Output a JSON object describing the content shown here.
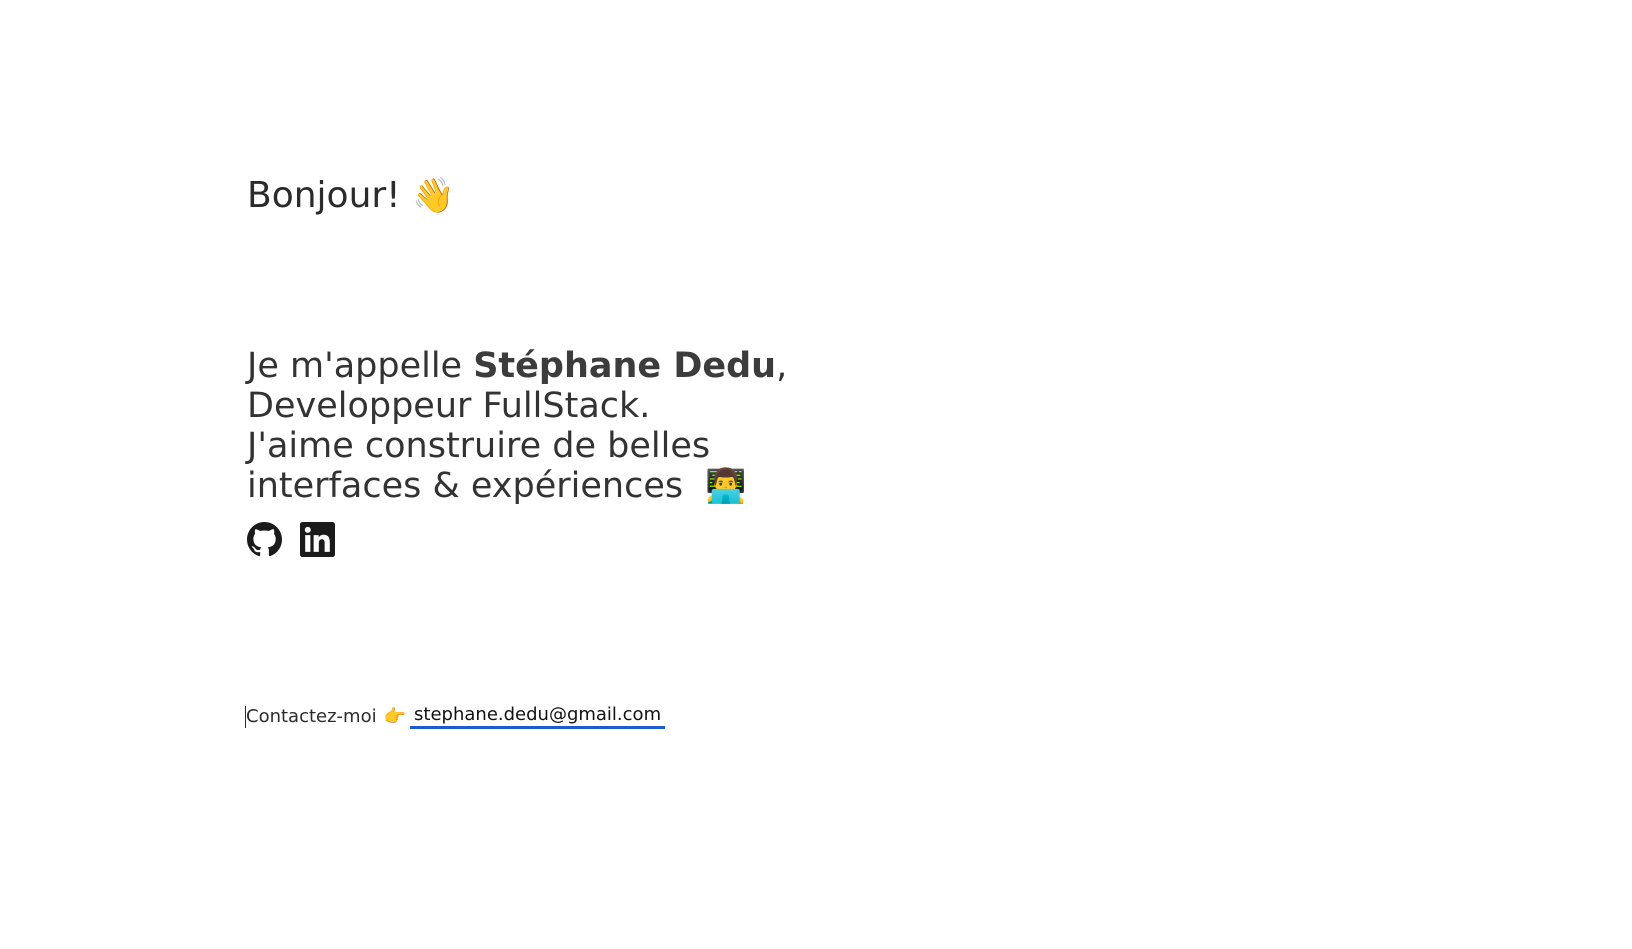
{
  "hero": {
    "greeting": "Bonjour!",
    "wave_emoji": "👋",
    "intro_prefix": "Je m'appelle ",
    "name": "Stéphane Dedu",
    "name_suffix": ",",
    "role": "Developpeur FullStack.",
    "tagline_line1": "J'aime construire de belles",
    "tagline_line2": "interfaces & expériences",
    "developer_emoji": "👨‍💻"
  },
  "socials": {
    "items": [
      {
        "icon": "github-icon"
      },
      {
        "icon": "linkedin-icon"
      }
    ]
  },
  "contact": {
    "label": "Contactez-moi",
    "pointer_emoji": "👉",
    "email": "stephane.dedu@gmail.com",
    "link_underline_color": "#1e5bd0"
  }
}
